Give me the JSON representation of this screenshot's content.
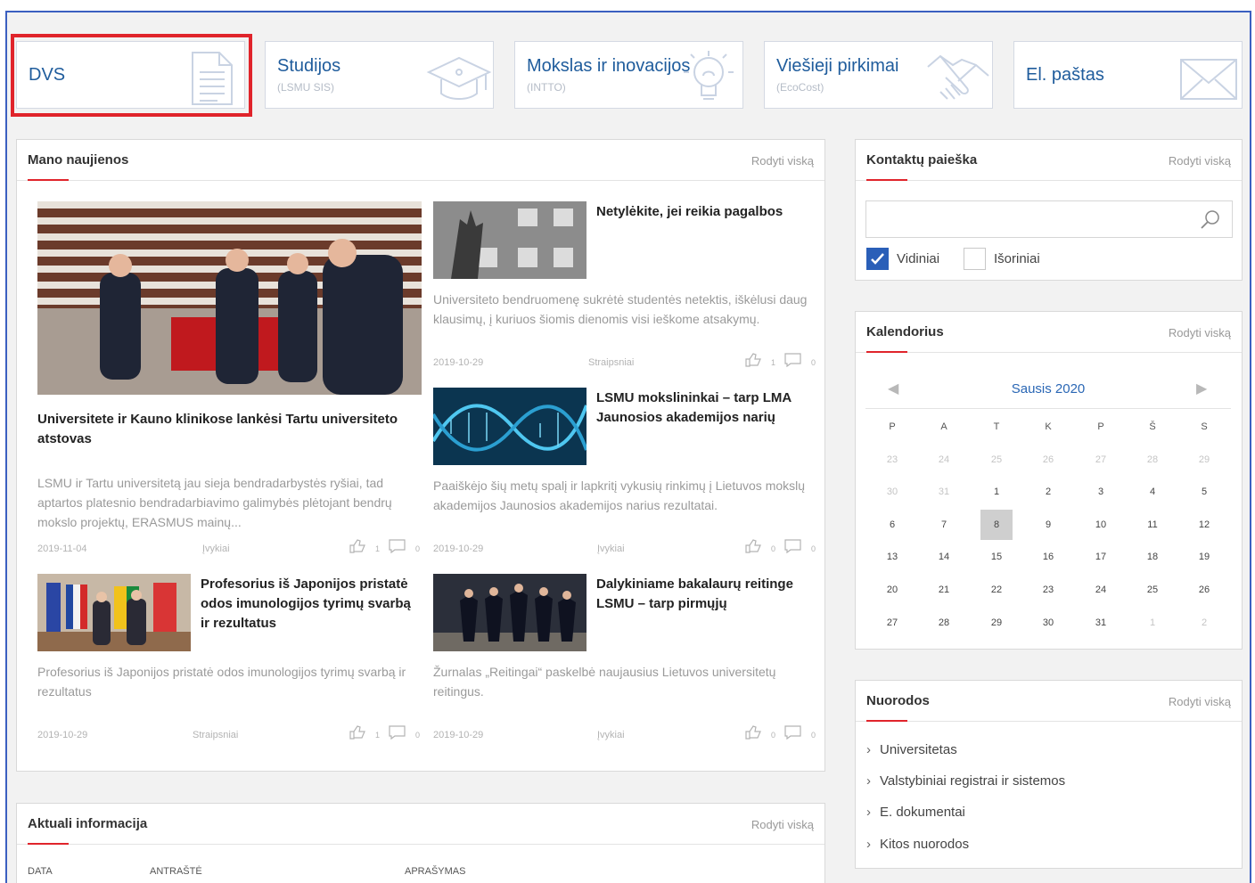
{
  "tiles": [
    {
      "title": "DVS",
      "sub": "",
      "icon": "document-icon"
    },
    {
      "title": "Studijos",
      "sub": "(LSMU SIS)",
      "icon": "graduation-cap-icon"
    },
    {
      "title": "Mokslas ir inovacijos",
      "sub": "(INTTO)",
      "icon": "lightbulb-icon"
    },
    {
      "title": "Viešieji pirkimai",
      "sub": "(EcoCost)",
      "icon": "handshake-icon"
    },
    {
      "title": "El. paštas",
      "sub": "",
      "icon": "envelope-icon"
    }
  ],
  "news": {
    "title": "Mano naujienos",
    "more": "Rodyti viską",
    "items": [
      {
        "title": "Universitete ir Kauno klinikose lankėsi Tartu universiteto atstovas",
        "desc": "LSMU ir Tartu universitetą jau sieja bendradarbystės ryšiai, tad aptartos platesnio bendradarbiavimo galimybės plėtojant bendrų mokslo projektų, ERASMUS mainų...",
        "date": "2019-11-04",
        "type": "Įvykiai",
        "likes": "1",
        "comments": "0"
      },
      {
        "title": "Netylėkite, jei reikia pagalbos",
        "desc": "Universiteto bendruomenę sukrėtė studentės netektis, iškėlusi daug klausimų, į kuriuos šiomis dienomis visi ieškome atsakymų.",
        "date": "2019-10-29",
        "type": "Straipsniai",
        "likes": "1",
        "comments": "0"
      },
      {
        "title": "LSMU mokslininkai – tarp LMA Jaunosios akademijos narių",
        "desc": "Paaiškėjo šių metų spalį ir lapkritį vykusių rinkimų į Lietuvos mokslų akademijos Jaunosios akademijos narius rezultatai.",
        "date": "2019-10-29",
        "type": "Įvykiai",
        "likes": "0",
        "comments": "0"
      },
      {
        "title": "Profesorius iš Japonijos pristatė odos imunologijos tyrimų svarbą ir rezultatus",
        "desc": "Profesorius iš Japonijos pristatė odos imunologijos tyrimų svarbą ir rezultatus",
        "date": "2019-10-29",
        "type": "Straipsniai",
        "likes": "1",
        "comments": "0"
      },
      {
        "title": "Dalykiniame bakalaurų reitinge LSMU – tarp pirmųjų",
        "desc": "Žurnalas „Reitingai“ paskelbė naujausius Lietuvos universitetų reitingus.",
        "date": "2019-10-29",
        "type": "Įvykiai",
        "likes": "0",
        "comments": "0"
      }
    ]
  },
  "info": {
    "title": "Aktuali informacija",
    "more": "Rodyti viską",
    "columns": [
      "DATA",
      "ANTRAŠTĖ",
      "APRAŠYMAS"
    ]
  },
  "contacts": {
    "title": "Kontaktų paieška",
    "more": "Rodyti viską",
    "search_value": "",
    "internal_label": "Vidiniai",
    "internal_checked": true,
    "external_label": "Išoriniai",
    "external_checked": false
  },
  "calendar": {
    "title": "Kalendorius",
    "more": "Rodyti viską",
    "month": "Sausis 2020",
    "weekdays": [
      "P",
      "A",
      "T",
      "K",
      "P",
      "Š",
      "S"
    ],
    "weeks": [
      [
        "23",
        "24",
        "25",
        "26",
        "27",
        "28",
        "29"
      ],
      [
        "30",
        "31",
        "1",
        "2",
        "3",
        "4",
        "5"
      ],
      [
        "6",
        "7",
        "8",
        "9",
        "10",
        "11",
        "12"
      ],
      [
        "13",
        "14",
        "15",
        "16",
        "17",
        "18",
        "19"
      ],
      [
        "20",
        "21",
        "22",
        "23",
        "24",
        "25",
        "26"
      ],
      [
        "27",
        "28",
        "29",
        "30",
        "31",
        "1",
        "2"
      ]
    ],
    "today": "8"
  },
  "links": {
    "title": "Nuorodos",
    "more": "Rodyti viską",
    "items": [
      "Universitetas",
      "Valstybiniai registrai ir sistemos",
      "E. dokumentai",
      "Kitos nuorodos"
    ]
  },
  "colors": {
    "accent": "#e0242b",
    "brand": "#1f5c9c",
    "checkbox": "#2a5fb8"
  }
}
